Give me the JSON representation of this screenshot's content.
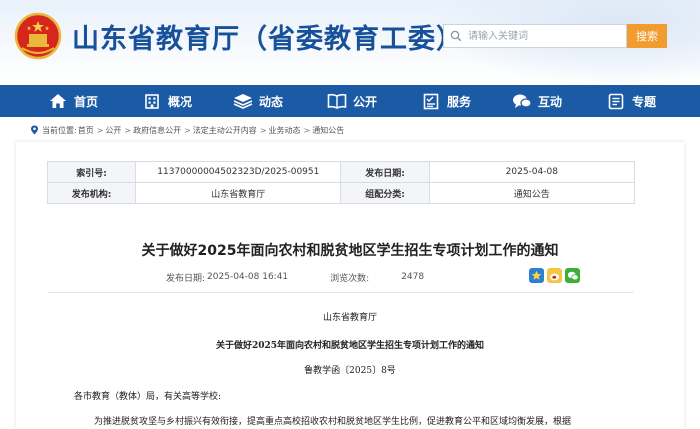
{
  "site": {
    "title": "山东省教育厅（省委教育工委）",
    "search_placeholder": "请输入关键词",
    "search_button": "搜索",
    "colors": {
      "brand_blue": "#1b5aa5",
      "title_blue": "#16519a",
      "search_orange": "#f29b2e"
    }
  },
  "nav": {
    "items": [
      {
        "label": "首页",
        "icon": "home-icon"
      },
      {
        "label": "概况",
        "icon": "building-icon"
      },
      {
        "label": "动态",
        "icon": "stack-icon"
      },
      {
        "label": "公开",
        "icon": "book-icon"
      },
      {
        "label": "服务",
        "icon": "checklist-icon"
      },
      {
        "label": "互动",
        "icon": "chat-icon"
      },
      {
        "label": "专题",
        "icon": "document-icon"
      }
    ]
  },
  "breadcrumb": {
    "prefix": "当前位置:",
    "items": [
      "首页",
      "公开",
      "政府信息公开",
      "法定主动公开内容",
      "业务动态",
      "通知公告"
    ]
  },
  "meta": {
    "index_label": "索引号:",
    "index_value": "11370000004502323D/2025-00951",
    "date_label": "发布日期:",
    "date_value": "2025-04-08",
    "org_label": "发布机构:",
    "org_value": "山东省教育厅",
    "category_label": "组配分类:",
    "category_value": "通知公告"
  },
  "article": {
    "title": "关于做好2025年面向农村和脱贫地区学生招生专项计划工作的通知",
    "publish_label": "发布日期:",
    "publish_time": "2025-04-08 16:41",
    "views_label": "浏览次数:",
    "views": "2478",
    "issuer": "山东省教育厅",
    "body_title": "关于做好2025年面向农村和脱贫地区学生招生专项计划工作的通知",
    "doc_number": "鲁教学函〔2025〕8号",
    "salutation": "各市教育（教体）局，有关高等学校:",
    "paragraph": "为推进脱贫攻坚与乡村振兴有效衔接，提高重点高校招收农村和脱贫地区学生比例，促进教育公平和区域均衡发展，根据"
  }
}
